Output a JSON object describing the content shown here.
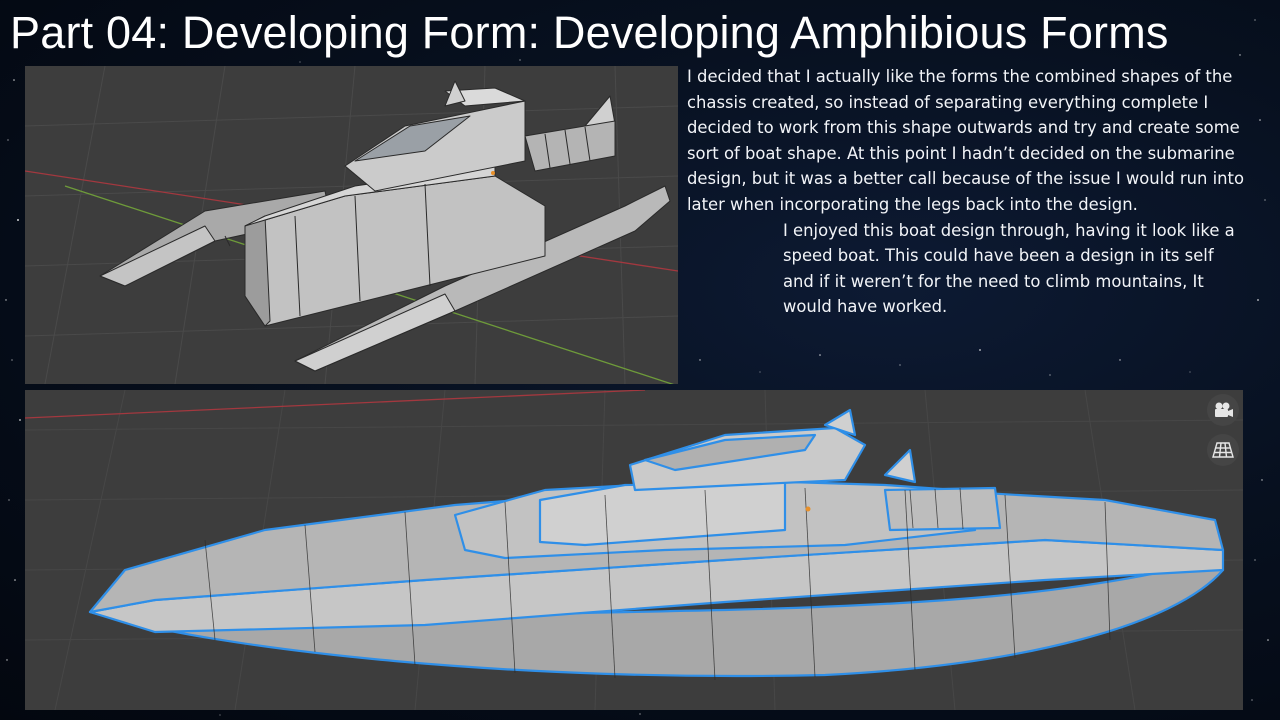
{
  "slide": {
    "title": "Part 04: Developing Form: Developing Amphibious Forms",
    "paragraphs": [
      "I decided that I actually like the forms the combined shapes of the chassis created, so instead of separating everything complete I decided to work from this shape outwards and try and create some sort of boat shape. At this point I hadn’t decided on the submarine design, but it was a better call because of the issue I would run into later when incorporating the legs back into the design.",
      "I enjoyed this boat design through, having it look like a speed boat. This could have been a design in its self and if it weren’t for the need to climb mountains, It would have worked."
    ]
  },
  "viewport_top": {
    "background_color": "#3d3d3d",
    "grid_color": "#4a4a4a",
    "x_axis_color": "#a3383f",
    "y_axis_color": "#6e9b3a",
    "model_color": "#bdbdbd",
    "edge_color": "#2a2a2a"
  },
  "viewport_bottom": {
    "background_color": "#3d3d3d",
    "selection_outline_color": "#2f8fe8",
    "model_color": "#bebebe",
    "origin_dot_color": "#e8902a",
    "buttons": [
      {
        "icon": "camera-icon"
      },
      {
        "icon": "grid-icon"
      }
    ]
  }
}
